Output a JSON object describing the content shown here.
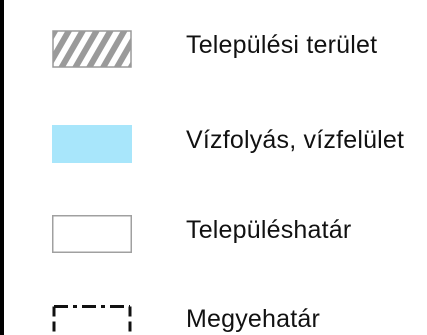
{
  "legend": {
    "items": [
      {
        "symbol": "hatched-area-icon",
        "label": "Települési terület",
        "hatch_color": "#9a9a9a",
        "border_color": "#9a9a9a"
      },
      {
        "symbol": "water-area-icon",
        "label": "Vízfolyás, vízfelület",
        "fill_color": "#a8e6fb"
      },
      {
        "symbol": "settlement-boundary-icon",
        "label": "Településhatár",
        "border_color": "#a0a0a0"
      },
      {
        "symbol": "county-boundary-icon",
        "label": "Megyehatár",
        "border_color": "#111111"
      }
    ]
  }
}
